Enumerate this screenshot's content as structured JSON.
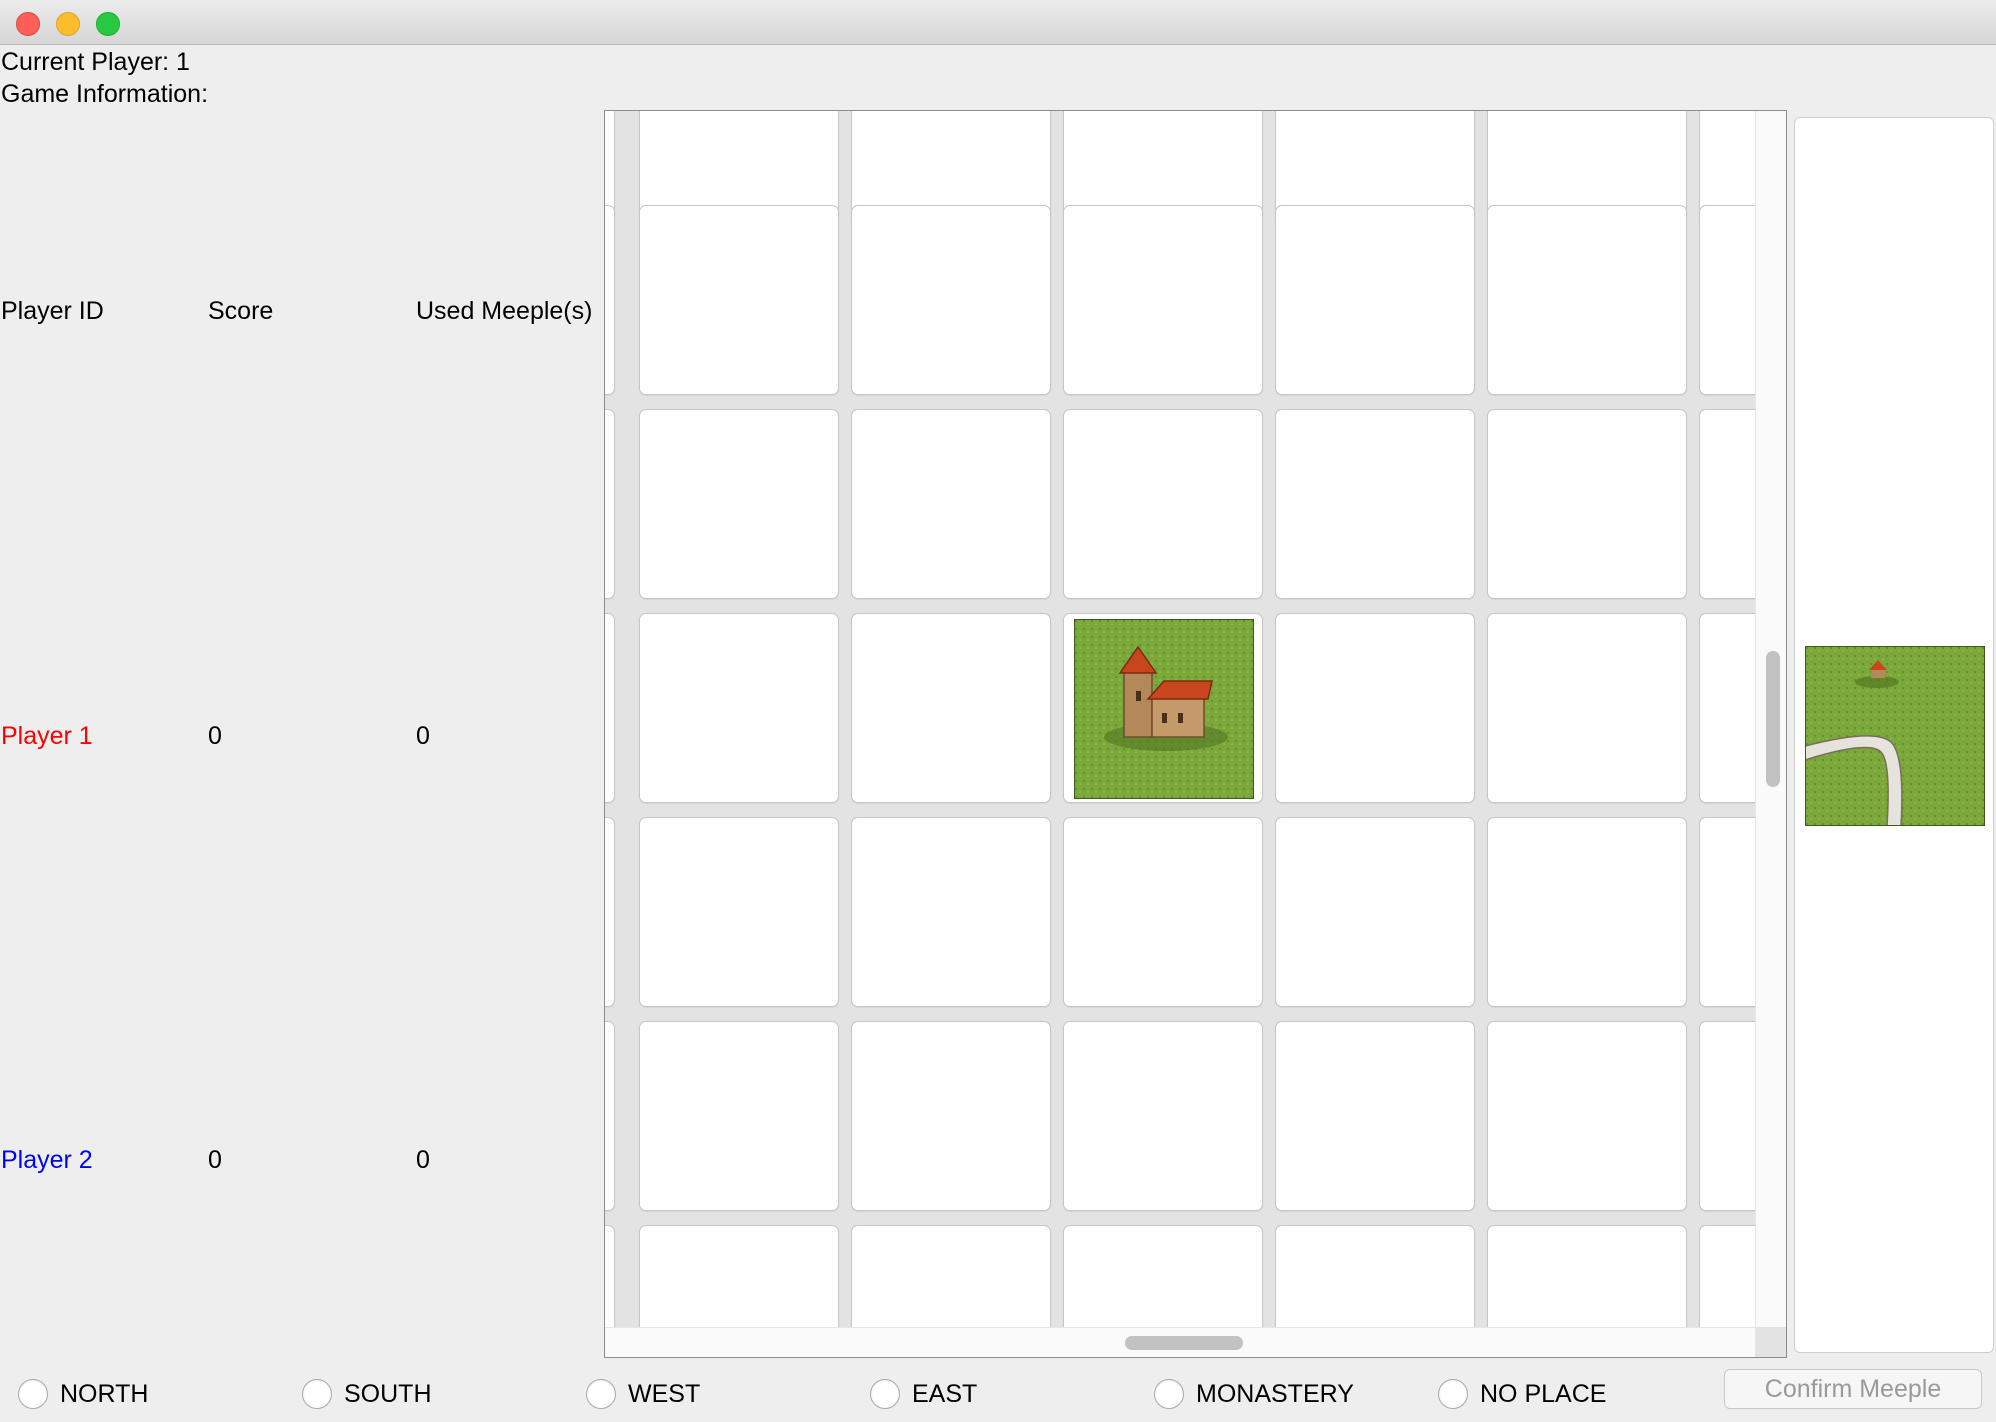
{
  "status": {
    "current_player": "Current Player: 1",
    "game_info": "Game Information:"
  },
  "table": {
    "headers": [
      "Player ID",
      "Score",
      "Used Meeple(s)"
    ],
    "rows": [
      {
        "player": "Player 1",
        "score": "0",
        "meeples": "0",
        "color": "#ff0000"
      },
      {
        "player": "Player 2",
        "score": "0",
        "meeples": "0",
        "color": "#0000ff"
      }
    ]
  },
  "board": {
    "placed_tile": "monastery-tile",
    "colors": {
      "grass": "#7aa83a",
      "roof": "#c8461e",
      "road": "#e6e2dc"
    }
  },
  "next_tile": {
    "tile": "monastery-road-curve-tile"
  },
  "meeple_options": [
    "NORTH",
    "SOUTH",
    "WEST",
    "EAST",
    "MONASTERY",
    "NO PLACE"
  ],
  "confirm_button": "Confirm Meeple"
}
